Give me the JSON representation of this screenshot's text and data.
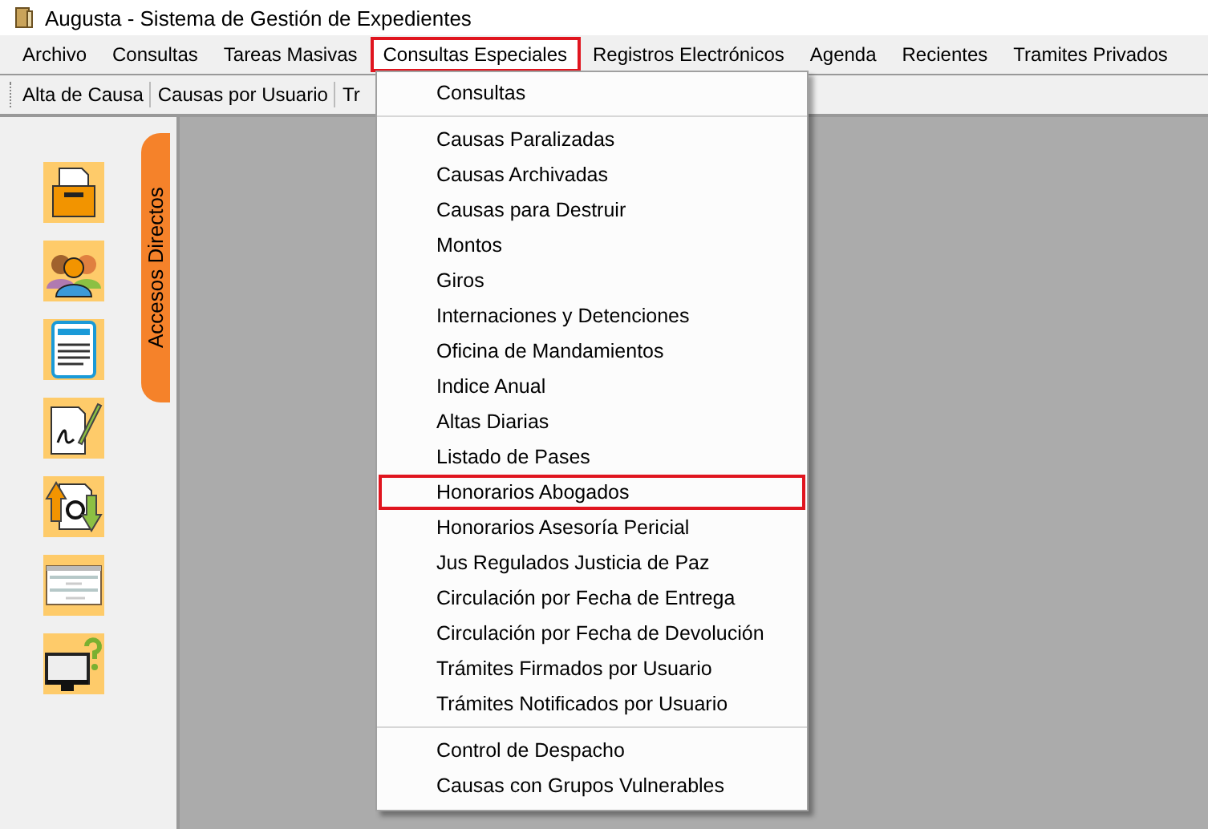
{
  "window": {
    "title": "Augusta - Sistema de Gestión de Expedientes"
  },
  "menu_bar": [
    {
      "label": "Archivo",
      "selected": false,
      "highlighted": false
    },
    {
      "label": "Consultas",
      "selected": false,
      "highlighted": false
    },
    {
      "label": "Tareas Masivas",
      "selected": false,
      "highlighted": false
    },
    {
      "label": "Consultas Especiales",
      "selected": true,
      "highlighted": true
    },
    {
      "label": "Registros Electrónicos",
      "selected": false,
      "highlighted": false
    },
    {
      "label": "Agenda",
      "selected": false,
      "highlighted": false
    },
    {
      "label": "Recientes",
      "selected": false,
      "highlighted": false
    },
    {
      "label": "Tramites Privados",
      "selected": false,
      "highlighted": false
    }
  ],
  "toolbar": [
    "Alta de Causa",
    "Causas por Usuario",
    "Tr"
  ],
  "side_tab": {
    "label": "Accesos Directos"
  },
  "dropdown": {
    "sections": [
      {
        "items": [
          {
            "label": "Consultas",
            "highlighted": false
          }
        ]
      },
      {
        "items": [
          {
            "label": "Causas Paralizadas",
            "highlighted": false
          },
          {
            "label": "Causas Archivadas",
            "highlighted": false
          },
          {
            "label": "Causas para Destruir",
            "highlighted": false
          },
          {
            "label": "Montos",
            "highlighted": false
          },
          {
            "label": "Giros",
            "highlighted": false
          },
          {
            "label": "Internaciones y Detenciones",
            "highlighted": false
          },
          {
            "label": "Oficina de Mandamientos",
            "highlighted": false
          },
          {
            "label": "Indice Anual",
            "highlighted": false
          },
          {
            "label": "Altas Diarias",
            "highlighted": false
          },
          {
            "label": "Listado de Pases",
            "highlighted": false
          },
          {
            "label": "Honorarios Abogados",
            "highlighted": true
          },
          {
            "label": "Honorarios Asesoría Pericial",
            "highlighted": false
          },
          {
            "label": "Jus Regulados Justicia de Paz",
            "highlighted": false
          },
          {
            "label": "Circulación por Fecha de Entrega",
            "highlighted": false
          },
          {
            "label": "Circulación por Fecha de Devolución",
            "highlighted": false
          },
          {
            "label": "Trámites Firmados por Usuario",
            "highlighted": false
          },
          {
            "label": "Trámites Notificados por Usuario",
            "highlighted": false
          }
        ]
      },
      {
        "items": [
          {
            "label": "Control de Despacho",
            "highlighted": false
          },
          {
            "label": "Causas con Grupos Vulnerables",
            "highlighted": false
          }
        ]
      }
    ]
  }
}
